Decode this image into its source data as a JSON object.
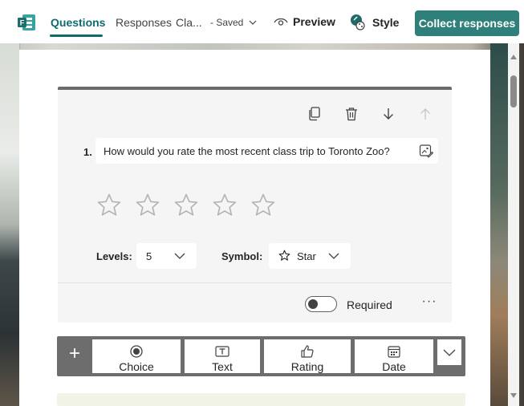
{
  "header": {
    "tabs": [
      {
        "label": "Questions",
        "active": true
      },
      {
        "label": "Responses",
        "active": false
      }
    ],
    "form_title": "Cla...",
    "save_status": "- Saved",
    "preview_label": "Preview",
    "style_label": "Style",
    "collect_label": "Collect responses"
  },
  "question": {
    "number": "1.",
    "text": "How would you rate the most recent class trip to Toronto Zoo?",
    "star_count": 5,
    "levels_label": "Levels:",
    "levels_value": "5",
    "symbol_label": "Symbol:",
    "symbol_value": "Star",
    "required_label": "Required",
    "required_on": false,
    "more_label": "···"
  },
  "add_bar": {
    "plus": "+",
    "types": [
      {
        "label": "Choice",
        "icon": "radio-icon"
      },
      {
        "label": "Text",
        "icon": "text-icon"
      },
      {
        "label": "Rating",
        "icon": "thumbs-up-icon"
      },
      {
        "label": "Date",
        "icon": "calendar-icon"
      }
    ]
  },
  "colors": {
    "accent": "#0f6b6b",
    "collect_button": "#2f7f7b",
    "card_background": "#f5f5f5",
    "toolbar": "#6d6d6d"
  }
}
